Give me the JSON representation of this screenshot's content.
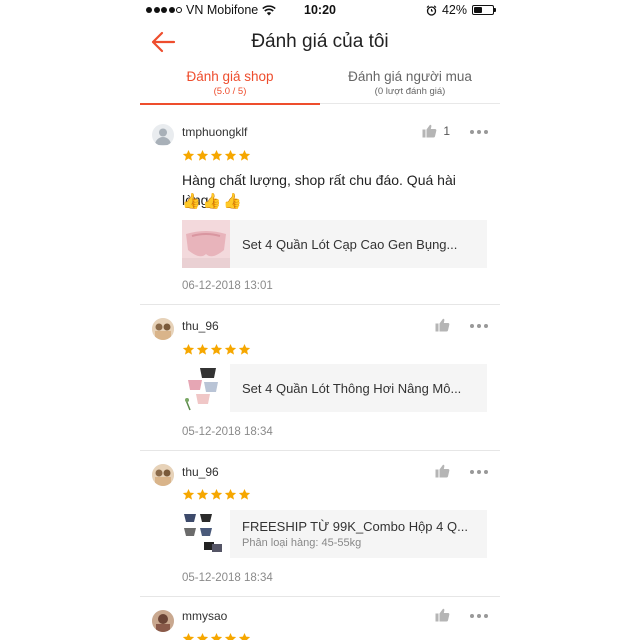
{
  "status_bar": {
    "carrier": "VN Mobifone",
    "time": "10:20",
    "battery": "42%",
    "battery_level": 0.42,
    "signal_bars": 4
  },
  "nav": {
    "title": "Đánh giá của tôi",
    "back_icon": "arrow-left-icon",
    "accent": "#ee4d2d"
  },
  "tabs": [
    {
      "label": "Đánh giá shop",
      "sub": "(5.0 / 5)",
      "active": true
    },
    {
      "label": "Đánh giá người mua",
      "sub": "(0 lượt đánh giá)",
      "active": false
    }
  ],
  "reviews": [
    {
      "username": "tmphuongklf",
      "rating": 5,
      "like_count": "1",
      "comment": "Hàng chất lượng, shop rất chu đáo. Quá hài lòng",
      "emoji": [
        "👍",
        "👍",
        "👍"
      ],
      "product_name": "Set 4 Quần Lót Cạp Cao Gen Bụng...",
      "variant": "",
      "date": "06-12-2018 13:01"
    },
    {
      "username": "thu_96",
      "rating": 5,
      "like_count": "",
      "comment": "",
      "product_name": "Set 4 Quần Lót Thông Hơi Nâng Mô...",
      "variant": "",
      "date": "05-12-2018 18:34"
    },
    {
      "username": "thu_96",
      "rating": 5,
      "like_count": "",
      "comment": "",
      "product_name": "FREESHIP TỪ 99K_Combo Hộp 4 Q...",
      "variant": "Phân loại hàng: 45-55kg",
      "date": "05-12-2018 18:34"
    },
    {
      "username": "mmysao",
      "rating": 5,
      "like_count": "",
      "comment": "",
      "product_name": "",
      "variant": "",
      "date": ""
    }
  ],
  "colors": {
    "star": "#f6a700",
    "accent": "#ee4d2d"
  }
}
